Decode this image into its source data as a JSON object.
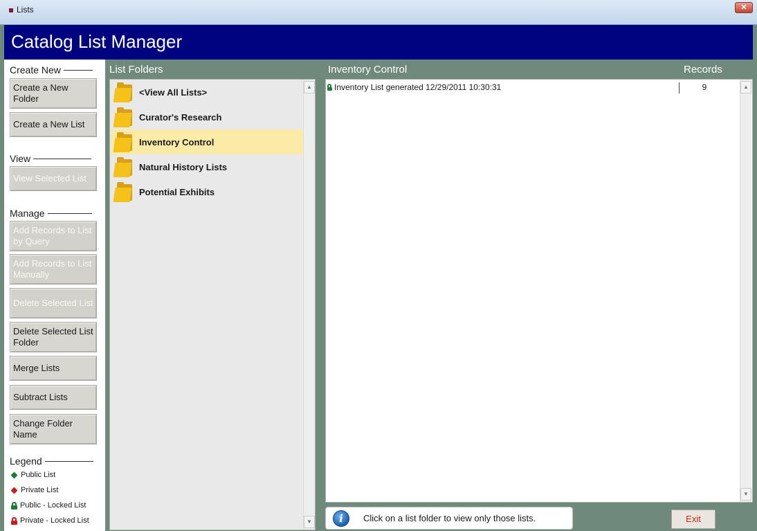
{
  "window": {
    "title": "Lists"
  },
  "header": {
    "title": "Catalog List Manager"
  },
  "sidebar": {
    "create_new": {
      "label": "Create New",
      "buttons": [
        "Create a New Folder",
        "Create a New List"
      ]
    },
    "view": {
      "label": "View",
      "buttons": [
        "View Selected List"
      ]
    },
    "manage": {
      "label": "Manage",
      "buttons": [
        "Add Records to List by Query",
        "Add Records to List Manually",
        "Delete Selected List",
        "Delete Selected List Folder",
        "Merge Lists",
        "Subtract Lists",
        "Change Folder Name"
      ]
    },
    "legend": {
      "label": "Legend",
      "items": [
        "Public List",
        "Private List",
        "Public - Locked List",
        "Private - Locked List"
      ]
    }
  },
  "folders": {
    "header": "List Folders",
    "items": [
      "<View All Lists>",
      "Curator's Research",
      "Inventory Control",
      "Natural History Lists",
      "Potential Exhibits"
    ],
    "selected": "Inventory Control"
  },
  "lists": {
    "header": "Inventory Control",
    "records_header": "Records",
    "rows": [
      {
        "name": "Inventory List generated 12/29/2011 10:30:31",
        "records": "9"
      }
    ]
  },
  "info": {
    "text": "Click on a list folder to view only those lists."
  },
  "footer": {
    "exit_label": "Exit"
  },
  "colors": {
    "header_bg": "#00037f",
    "frame": "#6f8a7c",
    "selected_folder": "#fbeba6",
    "public": "#1d7a3a",
    "private": "#c81e1e",
    "exit_text": "#c0281c"
  }
}
